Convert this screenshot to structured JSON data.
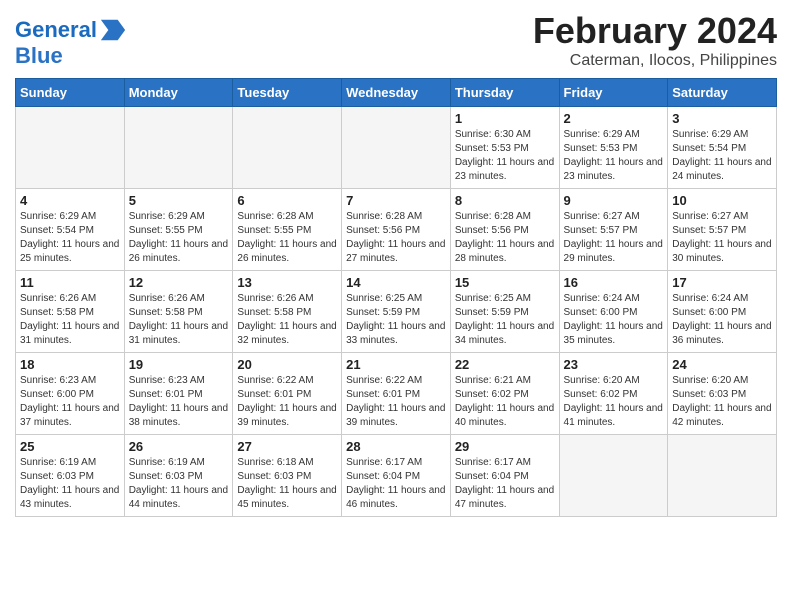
{
  "header": {
    "logo_line1": "General",
    "logo_line2": "Blue",
    "month_title": "February 2024",
    "location": "Caterman, Ilocos, Philippines"
  },
  "weekdays": [
    "Sunday",
    "Monday",
    "Tuesday",
    "Wednesday",
    "Thursday",
    "Friday",
    "Saturday"
  ],
  "weeks": [
    [
      {
        "day": "",
        "sunrise": "",
        "sunset": "",
        "daylight": "",
        "empty": true
      },
      {
        "day": "",
        "sunrise": "",
        "sunset": "",
        "daylight": "",
        "empty": true
      },
      {
        "day": "",
        "sunrise": "",
        "sunset": "",
        "daylight": "",
        "empty": true
      },
      {
        "day": "",
        "sunrise": "",
        "sunset": "",
        "daylight": "",
        "empty": true
      },
      {
        "day": "1",
        "sunrise": "Sunrise: 6:30 AM",
        "sunset": "Sunset: 5:53 PM",
        "daylight": "Daylight: 11 hours and 23 minutes.",
        "empty": false
      },
      {
        "day": "2",
        "sunrise": "Sunrise: 6:29 AM",
        "sunset": "Sunset: 5:53 PM",
        "daylight": "Daylight: 11 hours and 23 minutes.",
        "empty": false
      },
      {
        "day": "3",
        "sunrise": "Sunrise: 6:29 AM",
        "sunset": "Sunset: 5:54 PM",
        "daylight": "Daylight: 11 hours and 24 minutes.",
        "empty": false
      }
    ],
    [
      {
        "day": "4",
        "sunrise": "Sunrise: 6:29 AM",
        "sunset": "Sunset: 5:54 PM",
        "daylight": "Daylight: 11 hours and 25 minutes.",
        "empty": false
      },
      {
        "day": "5",
        "sunrise": "Sunrise: 6:29 AM",
        "sunset": "Sunset: 5:55 PM",
        "daylight": "Daylight: 11 hours and 26 minutes.",
        "empty": false
      },
      {
        "day": "6",
        "sunrise": "Sunrise: 6:28 AM",
        "sunset": "Sunset: 5:55 PM",
        "daylight": "Daylight: 11 hours and 26 minutes.",
        "empty": false
      },
      {
        "day": "7",
        "sunrise": "Sunrise: 6:28 AM",
        "sunset": "Sunset: 5:56 PM",
        "daylight": "Daylight: 11 hours and 27 minutes.",
        "empty": false
      },
      {
        "day": "8",
        "sunrise": "Sunrise: 6:28 AM",
        "sunset": "Sunset: 5:56 PM",
        "daylight": "Daylight: 11 hours and 28 minutes.",
        "empty": false
      },
      {
        "day": "9",
        "sunrise": "Sunrise: 6:27 AM",
        "sunset": "Sunset: 5:57 PM",
        "daylight": "Daylight: 11 hours and 29 minutes.",
        "empty": false
      },
      {
        "day": "10",
        "sunrise": "Sunrise: 6:27 AM",
        "sunset": "Sunset: 5:57 PM",
        "daylight": "Daylight: 11 hours and 30 minutes.",
        "empty": false
      }
    ],
    [
      {
        "day": "11",
        "sunrise": "Sunrise: 6:26 AM",
        "sunset": "Sunset: 5:58 PM",
        "daylight": "Daylight: 11 hours and 31 minutes.",
        "empty": false
      },
      {
        "day": "12",
        "sunrise": "Sunrise: 6:26 AM",
        "sunset": "Sunset: 5:58 PM",
        "daylight": "Daylight: 11 hours and 31 minutes.",
        "empty": false
      },
      {
        "day": "13",
        "sunrise": "Sunrise: 6:26 AM",
        "sunset": "Sunset: 5:58 PM",
        "daylight": "Daylight: 11 hours and 32 minutes.",
        "empty": false
      },
      {
        "day": "14",
        "sunrise": "Sunrise: 6:25 AM",
        "sunset": "Sunset: 5:59 PM",
        "daylight": "Daylight: 11 hours and 33 minutes.",
        "empty": false
      },
      {
        "day": "15",
        "sunrise": "Sunrise: 6:25 AM",
        "sunset": "Sunset: 5:59 PM",
        "daylight": "Daylight: 11 hours and 34 minutes.",
        "empty": false
      },
      {
        "day": "16",
        "sunrise": "Sunrise: 6:24 AM",
        "sunset": "Sunset: 6:00 PM",
        "daylight": "Daylight: 11 hours and 35 minutes.",
        "empty": false
      },
      {
        "day": "17",
        "sunrise": "Sunrise: 6:24 AM",
        "sunset": "Sunset: 6:00 PM",
        "daylight": "Daylight: 11 hours and 36 minutes.",
        "empty": false
      }
    ],
    [
      {
        "day": "18",
        "sunrise": "Sunrise: 6:23 AM",
        "sunset": "Sunset: 6:00 PM",
        "daylight": "Daylight: 11 hours and 37 minutes.",
        "empty": false
      },
      {
        "day": "19",
        "sunrise": "Sunrise: 6:23 AM",
        "sunset": "Sunset: 6:01 PM",
        "daylight": "Daylight: 11 hours and 38 minutes.",
        "empty": false
      },
      {
        "day": "20",
        "sunrise": "Sunrise: 6:22 AM",
        "sunset": "Sunset: 6:01 PM",
        "daylight": "Daylight: 11 hours and 39 minutes.",
        "empty": false
      },
      {
        "day": "21",
        "sunrise": "Sunrise: 6:22 AM",
        "sunset": "Sunset: 6:01 PM",
        "daylight": "Daylight: 11 hours and 39 minutes.",
        "empty": false
      },
      {
        "day": "22",
        "sunrise": "Sunrise: 6:21 AM",
        "sunset": "Sunset: 6:02 PM",
        "daylight": "Daylight: 11 hours and 40 minutes.",
        "empty": false
      },
      {
        "day": "23",
        "sunrise": "Sunrise: 6:20 AM",
        "sunset": "Sunset: 6:02 PM",
        "daylight": "Daylight: 11 hours and 41 minutes.",
        "empty": false
      },
      {
        "day": "24",
        "sunrise": "Sunrise: 6:20 AM",
        "sunset": "Sunset: 6:03 PM",
        "daylight": "Daylight: 11 hours and 42 minutes.",
        "empty": false
      }
    ],
    [
      {
        "day": "25",
        "sunrise": "Sunrise: 6:19 AM",
        "sunset": "Sunset: 6:03 PM",
        "daylight": "Daylight: 11 hours and 43 minutes.",
        "empty": false
      },
      {
        "day": "26",
        "sunrise": "Sunrise: 6:19 AM",
        "sunset": "Sunset: 6:03 PM",
        "daylight": "Daylight: 11 hours and 44 minutes.",
        "empty": false
      },
      {
        "day": "27",
        "sunrise": "Sunrise: 6:18 AM",
        "sunset": "Sunset: 6:03 PM",
        "daylight": "Daylight: 11 hours and 45 minutes.",
        "empty": false
      },
      {
        "day": "28",
        "sunrise": "Sunrise: 6:17 AM",
        "sunset": "Sunset: 6:04 PM",
        "daylight": "Daylight: 11 hours and 46 minutes.",
        "empty": false
      },
      {
        "day": "29",
        "sunrise": "Sunrise: 6:17 AM",
        "sunset": "Sunset: 6:04 PM",
        "daylight": "Daylight: 11 hours and 47 minutes.",
        "empty": false
      },
      {
        "day": "",
        "sunrise": "",
        "sunset": "",
        "daylight": "",
        "empty": true
      },
      {
        "day": "",
        "sunrise": "",
        "sunset": "",
        "daylight": "",
        "empty": true
      }
    ]
  ]
}
